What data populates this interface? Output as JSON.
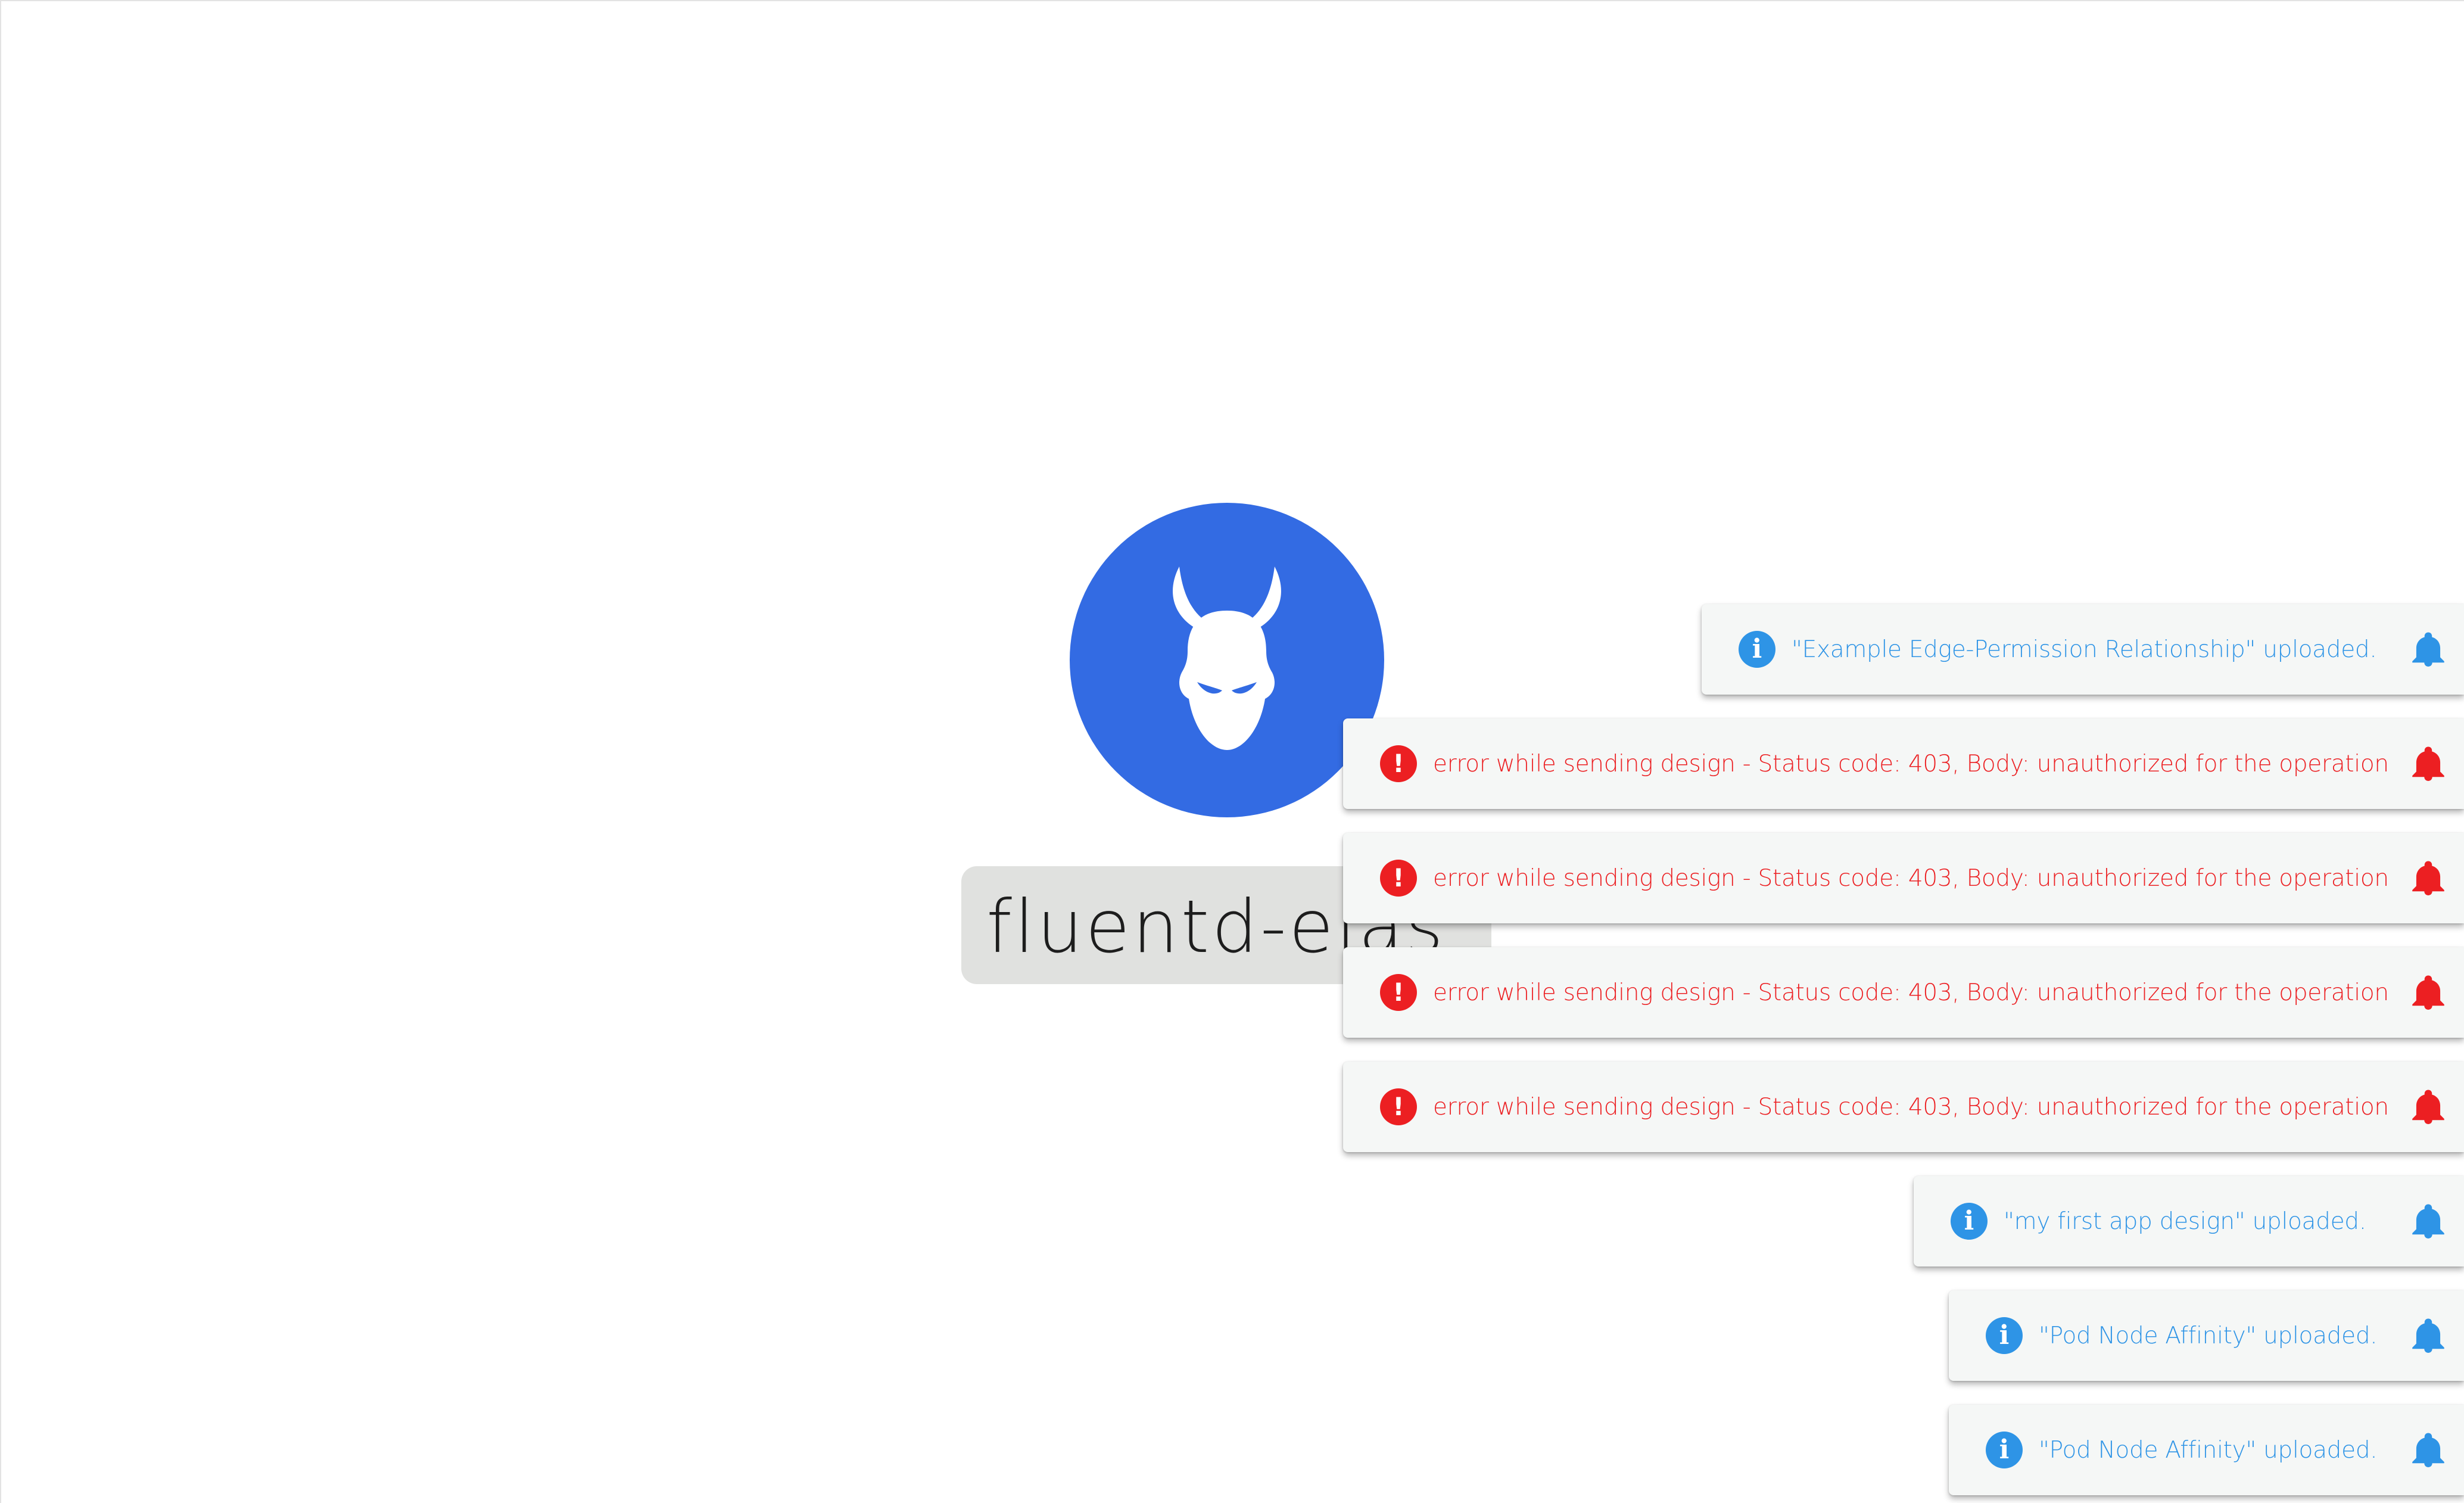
{
  "canvas": {
    "node": {
      "icon": "devil-horns-icon",
      "label": "fluentd-elas...",
      "avatar_color": "#336be3"
    }
  },
  "notifications": [
    {
      "kind": "info",
      "icon": "info-icon",
      "message": "\"Example Edge-Permission Relationship\" uploaded.",
      "action_icon": "bell-icon"
    },
    {
      "kind": "error",
      "icon": "error-icon",
      "message": "error while sending design - Status code: 403, Body: unauthorized for the operation",
      "action_icon": "bell-icon"
    },
    {
      "kind": "error",
      "icon": "error-icon",
      "message": "error while sending design - Status code: 403, Body: unauthorized for the operation",
      "action_icon": "bell-icon"
    },
    {
      "kind": "error",
      "icon": "error-icon",
      "message": "error while sending design - Status code: 403, Body: unauthorized for the operation",
      "action_icon": "bell-icon"
    },
    {
      "kind": "error",
      "icon": "error-icon",
      "message": "error while sending design - Status code: 403, Body: unauthorized for the operation",
      "action_icon": "bell-icon"
    },
    {
      "kind": "info",
      "icon": "info-icon",
      "message": "\"my first app design\" uploaded.",
      "action_icon": "bell-icon"
    },
    {
      "kind": "info",
      "icon": "info-icon",
      "message": "\"Pod Node Affinity\" uploaded.",
      "action_icon": "bell-icon"
    },
    {
      "kind": "info",
      "icon": "info-icon",
      "message": "\"Pod Node Affinity\" uploaded.",
      "action_icon": "bell-icon"
    }
  ],
  "colors": {
    "info": "#2e94e6",
    "error": "#ec1f22",
    "toast_bg": "#f5f7f6",
    "label_bg": "#e0e1df"
  }
}
